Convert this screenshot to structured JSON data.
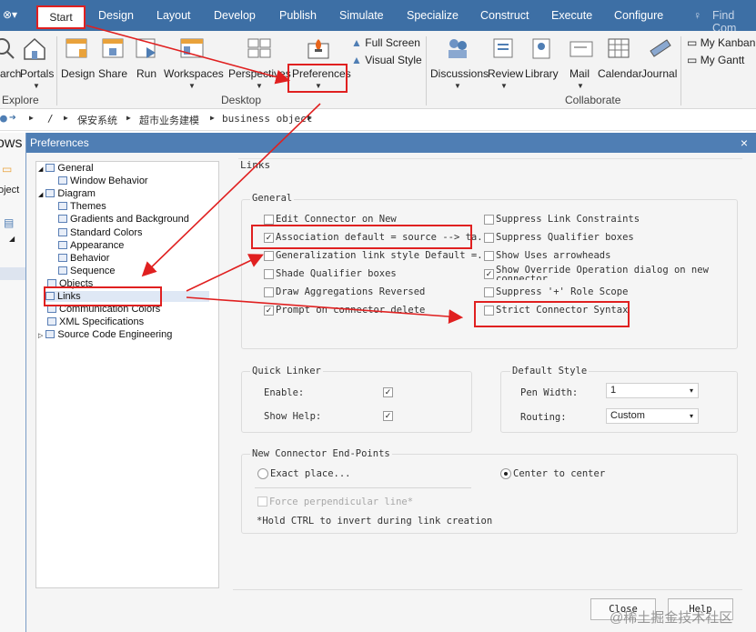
{
  "ribbon": {
    "tabs": [
      "Start",
      "Design",
      "Layout",
      "Develop",
      "Publish",
      "Simulate",
      "Specialize",
      "Construct",
      "Execute",
      "Configure"
    ],
    "find_placeholder": "Find Com",
    "buttons": {
      "search": "arch",
      "portals": "Portals",
      "design": "Design",
      "share": "Share",
      "run": "Run",
      "workspaces": "Workspaces",
      "perspectives": "Perspectives",
      "preferences": "Preferences",
      "full_screen": "Full Screen",
      "visual_style": "Visual Style",
      "discussions": "Discussions",
      "review": "Review",
      "library": "Library",
      "mail": "Mail",
      "calendar": "Calendar",
      "journal": "Journal",
      "my_kanban": "My Kanban",
      "my_gantt": "My Gantt"
    },
    "groups": {
      "explore": "Explore",
      "desktop": "Desktop",
      "collaborate": "Collaborate"
    }
  },
  "breadcrumb": [
    "/",
    "保安系统",
    "超市业务建模",
    "business object"
  ],
  "left_fragments": {
    "ows": "ows",
    "oject": "oject"
  },
  "dialog": {
    "title": "Preferences",
    "close": "×",
    "section_title": "Links",
    "tree": [
      {
        "label": "General",
        "indent": 0,
        "expander": "◢"
      },
      {
        "label": "Window Behavior",
        "indent": 1
      },
      {
        "label": "Diagram",
        "indent": 0,
        "expander": "◢"
      },
      {
        "label": "Themes",
        "indent": 1
      },
      {
        "label": "Gradients and Background",
        "indent": 1
      },
      {
        "label": "Standard Colors",
        "indent": 1
      },
      {
        "label": "Appearance",
        "indent": 1
      },
      {
        "label": "Behavior",
        "indent": 1
      },
      {
        "label": "Sequence",
        "indent": 1
      },
      {
        "label": "Objects",
        "indent": 0
      },
      {
        "label": "Links",
        "indent": 0,
        "selected": true
      },
      {
        "label": "Communication Colors",
        "indent": 0
      },
      {
        "label": "XML Specifications",
        "indent": 0
      },
      {
        "label": "Source Code Engineering",
        "indent": 0,
        "expander": "▷"
      }
    ],
    "general": {
      "title": "General",
      "left": [
        {
          "label": "Edit Connector on New",
          "checked": false
        },
        {
          "label": "Association default = source --> ta..",
          "checked": true
        },
        {
          "label": "Generalization link style Default =...",
          "checked": false
        },
        {
          "label": "Shade Qualifier boxes",
          "checked": false
        },
        {
          "label": "Draw Aggregations Reversed",
          "checked": false
        },
        {
          "label": "Prompt on connector delete",
          "checked": true
        }
      ],
      "right": [
        {
          "label": "Suppress Link Constraints",
          "checked": false
        },
        {
          "label": "Suppress Qualifier boxes",
          "checked": false
        },
        {
          "label": "Show Uses arrowheads",
          "checked": false
        },
        {
          "label": "Show Override Operation dialog on new connector",
          "checked": true
        },
        {
          "label": "Suppress '+' Role Scope",
          "checked": false
        },
        {
          "label": "Strict Connector Syntax",
          "checked": false
        }
      ]
    },
    "quick_linker": {
      "title": "Quick Linker",
      "enable": "Enable:",
      "show_help": "Show Help:",
      "enable_checked": true,
      "show_help_checked": true
    },
    "default_style": {
      "title": "Default Style",
      "pen_width_label": "Pen Width:",
      "pen_width": "1",
      "routing_label": "Routing:",
      "routing": "Custom"
    },
    "endpoints": {
      "title": "New Connector End-Points",
      "exact": "Exact place...",
      "center": "Center to center",
      "selected": "center",
      "force": "Force perpendicular line*",
      "note": "*Hold CTRL to invert during link creation"
    },
    "buttons": {
      "close": "Close",
      "help": "Help"
    }
  },
  "watermark": "@稀土掘金技术社区"
}
